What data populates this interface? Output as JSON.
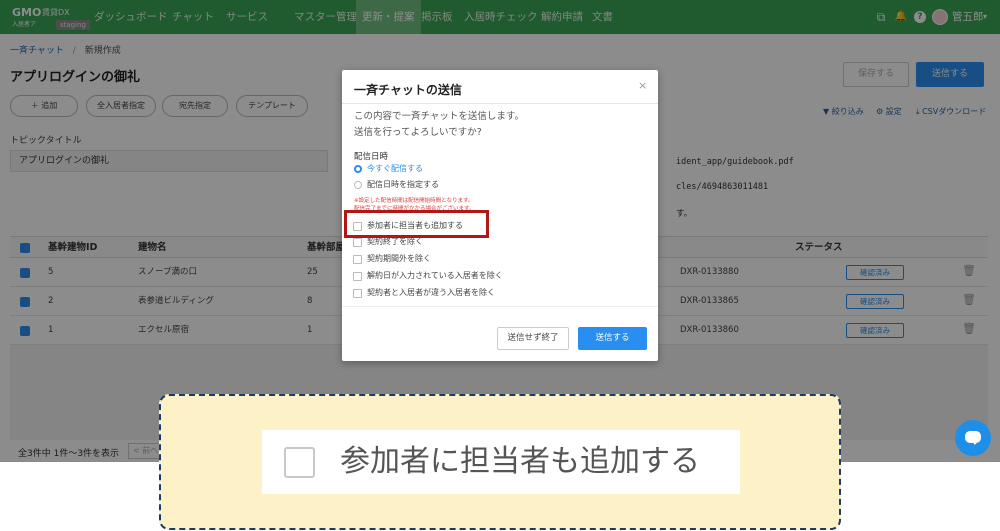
{
  "topbar": {
    "logo_text": "GMO",
    "logo_dx": "賃貸DX",
    "logo_sub": "入居者ア",
    "env_badge": "staging",
    "nav": [
      "ダッシュボード",
      "チャット",
      "サービス",
      "マスター管理",
      "更新・提案",
      "掲示板",
      "入居時チェック",
      "解約申請",
      "文書"
    ],
    "active_nav": "更新・提案",
    "user_name": "管五郎",
    "user_caret": "▾",
    "icons": {
      "copy": "⧉",
      "bell": "🔔",
      "help": "?"
    }
  },
  "breadcrumb": {
    "root": "一斉チャット",
    "sep": "/",
    "current": "新規作成"
  },
  "page": {
    "title": "アプリログインの御礼",
    "save_label": "保存する",
    "send_label": "送信する"
  },
  "pills": [
    {
      "label": "＋ 追加"
    },
    {
      "label": "全入居者指定"
    },
    {
      "label": "宛先指定"
    },
    {
      "label": "テンプレート"
    }
  ],
  "tools": {
    "filter": "絞り込み",
    "settings": "設定",
    "csv": "CSVダウンロード"
  },
  "topic": {
    "label": "トピックタイトル",
    "value": "アプリログインの御礼"
  },
  "message_lines": [
    "ident_app/guidebook.pdf",
    "cles/4694863011481",
    "す。"
  ],
  "table": {
    "headers": [
      "基幹建物ID",
      "建物名",
      "基幹部屋",
      "ステータス"
    ],
    "rows": [
      {
        "id": "5",
        "name": "スノープ満の口",
        "room": "25",
        "contract": "DXR-0133880",
        "status": "確認済み"
      },
      {
        "id": "2",
        "name": "表参道ビルディング",
        "room": "8",
        "contract": "DXR-0133865",
        "status": "確認済み"
      },
      {
        "id": "1",
        "name": "エクセル原宿",
        "room": "1",
        "contract": "DXR-0133860",
        "status": "確認済み"
      }
    ],
    "footer_count": "全3件中 1件〜3件を表示",
    "prev_label": "< 前へ"
  },
  "modal": {
    "title": "一斉チャットの送信",
    "close": "×",
    "message_1": "この内容で一斉チャットを送信します。",
    "message_2": "送信を行ってよろしいですか?",
    "schedule_label": "配信日時",
    "radio_now": "今すぐ配信する",
    "radio_schedule": "配信日時を指定する",
    "warning_1": "※設定した配信時間は配信開始時間となります。",
    "warning_2": "配信完了までに時間がかかる場合がございます。",
    "checkboxes": [
      "参加者に担当者も追加する",
      "契約終了を除く",
      "契約期間外を除く",
      "解約日が入力されている入居者を除く",
      "契約者と入居者が違う入居者を除く"
    ],
    "cancel_label": "送信せず終了",
    "send_label": "送信する"
  },
  "callout": {
    "text": "参加者に担当者も追加する"
  }
}
